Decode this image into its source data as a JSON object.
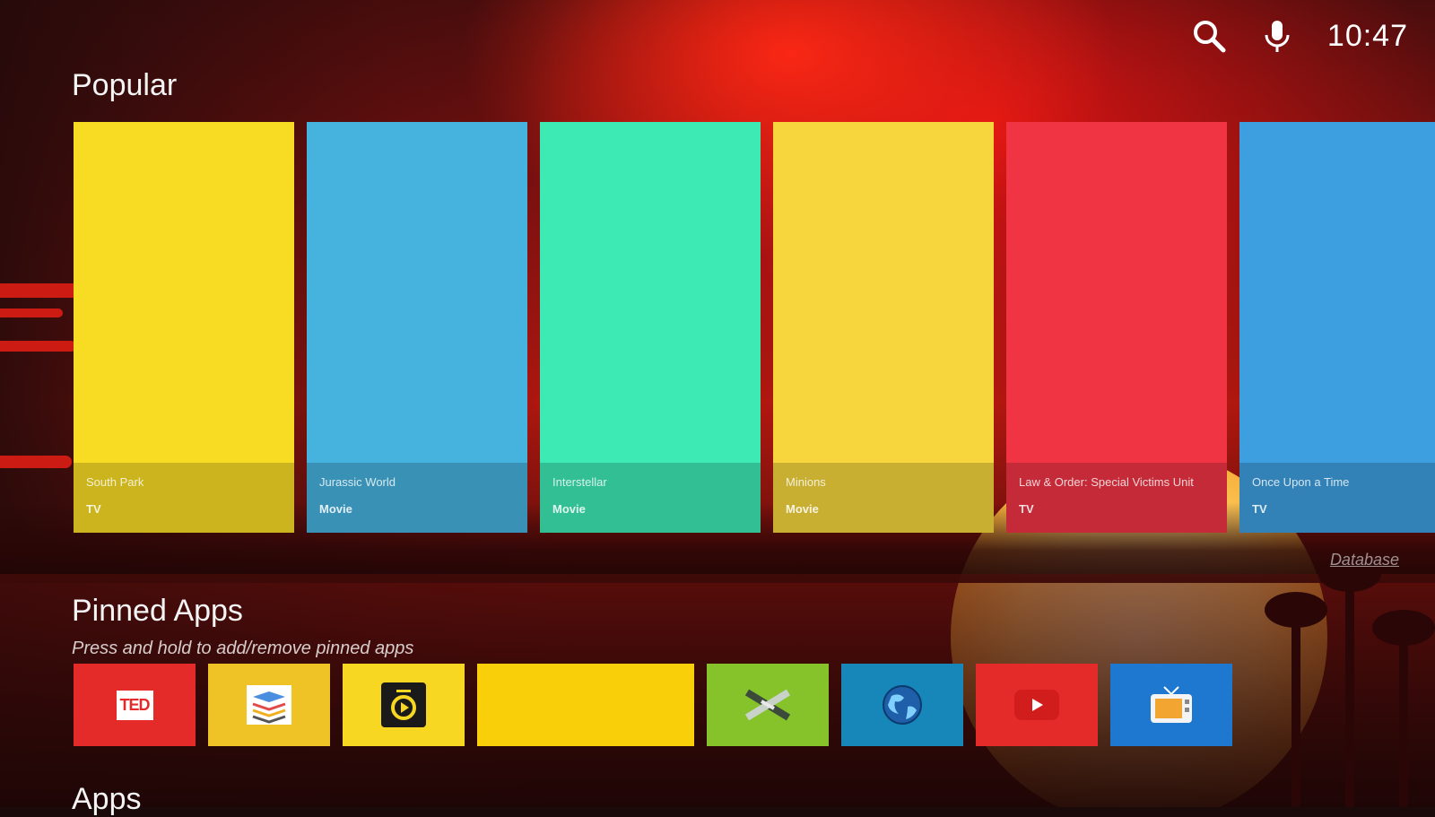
{
  "status": {
    "time": "10:47",
    "search_icon": "search-icon",
    "mic_icon": "mic-icon"
  },
  "popular": {
    "title": "Popular",
    "attribution": "Database",
    "cards": [
      {
        "title": "South Park",
        "type": "TV",
        "color": "#f8dc24"
      },
      {
        "title": "Jurassic World",
        "type": "Movie",
        "color": "#46b2de"
      },
      {
        "title": "Interstellar",
        "type": "Movie",
        "color": "#3eeab4"
      },
      {
        "title": "Minions",
        "type": "Movie",
        "color": "#f6d63c"
      },
      {
        "title": "Law & Order: Special Victims Unit",
        "type": "TV",
        "color": "#f03444"
      },
      {
        "title": "Once Upon a Time",
        "type": "TV",
        "color": "#3d9ee0"
      }
    ]
  },
  "pinned": {
    "title": "Pinned Apps",
    "hint": "Press and hold to add/remove pinned apps",
    "apps": [
      {
        "name": "ted-app",
        "icon": "ted-logo",
        "label": "TED",
        "color": "#e52a2a"
      },
      {
        "name": "stack-app",
        "icon": "stack-icon",
        "color": "#efc325"
      },
      {
        "name": "plex-app",
        "icon": "play-circle-icon",
        "color": "#f7d721"
      },
      {
        "name": "wide-app",
        "icon": "",
        "color": "#f8cf08"
      },
      {
        "name": "kodi-app",
        "icon": "cross-icon",
        "color": "#86c22a"
      },
      {
        "name": "browser-app",
        "icon": "globe-icon",
        "color": "#1687b8"
      },
      {
        "name": "youtube-app",
        "icon": "youtube-icon",
        "color": "#e52a2a"
      },
      {
        "name": "tv-app",
        "icon": "tv-icon",
        "color": "#1e78d0"
      }
    ]
  },
  "apps": {
    "title": "Apps"
  }
}
